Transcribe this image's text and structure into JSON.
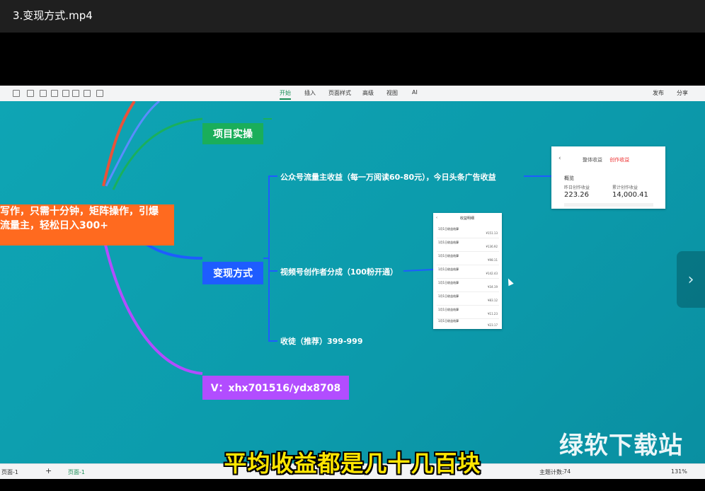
{
  "window": {
    "title": "3.变现方式.mp4"
  },
  "toolbar": {
    "tabs": [
      "开始",
      "插入",
      "页面样式",
      "高级",
      "视图",
      "AI"
    ],
    "active_tab": "开始",
    "publish": "发布",
    "share": "分享"
  },
  "mindmap": {
    "central_line1": "写作，只需十分钟，矩阵操作，引爆",
    "central_line2": "流量主，轻松日入300+",
    "project_node": "项目实操",
    "monetize_node": "变现方式",
    "contact_node": "V：xhx701516/ydx8708",
    "leaves": {
      "gzh": "公众号流量主收益（每一万阅读60-80元），今日头条广告收益",
      "sph": "视频号创作者分成（100粉开通）",
      "course": "收徒（推荐）399-999"
    }
  },
  "card1": {
    "tab_overall": "整体收益",
    "tab_creator": "创作收益",
    "overview": "概览",
    "yesterday_label": "昨日创作收益",
    "yesterday_value": "223.26",
    "total_label": "累计创作收益",
    "total_value": "14,000.41"
  },
  "card2": {
    "header": "收益明细",
    "rows": [
      {
        "a": "1月1日收益结算",
        "b": "¥151.13"
      },
      {
        "a": "1月1日收益结算",
        "b": "¥136.92"
      },
      {
        "a": "1月1日收益结算",
        "b": "¥98.11"
      },
      {
        "a": "1月1日收益结算",
        "b": "¥142.43"
      },
      {
        "a": "1月1日收益结算",
        "b": "¥34.19"
      },
      {
        "a": "1月1日收益结算",
        "b": "¥83.12"
      },
      {
        "a": "1月1日收益结算",
        "b": "¥11.23"
      },
      {
        "a": "1月1日收益结算",
        "b": "¥23.17"
      }
    ]
  },
  "statusbar": {
    "page": "页面-1",
    "page_tab": "页面-1",
    "topic_count_label": "主题计数:",
    "topic_count": "74",
    "zoom": "131%"
  },
  "subtitle": "平均收益都是几十几百块",
  "watermark": "绿软下载站",
  "colors": {
    "canvas": "#0fa3b1",
    "central": "#ff6a1f",
    "project": "#1aae5a",
    "monetize": "#1e5cff",
    "contact": "#b24dff",
    "subtitle": "#ffe600"
  }
}
